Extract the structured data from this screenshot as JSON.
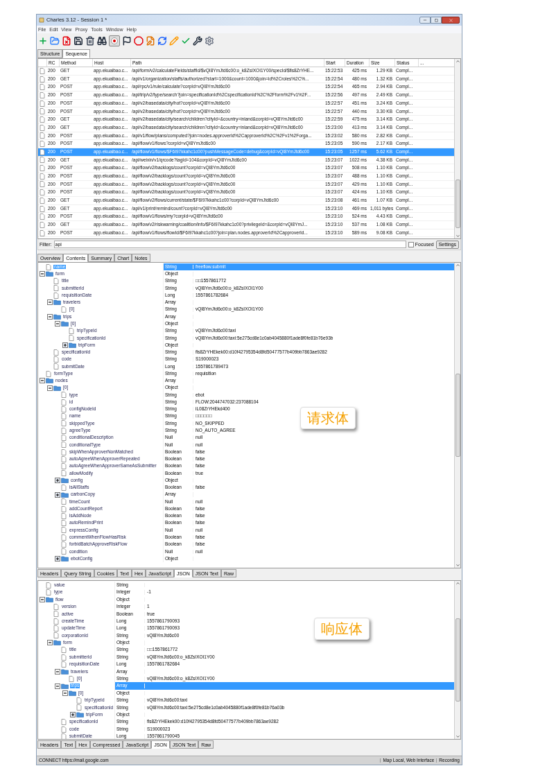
{
  "window": {
    "title": "Charles 3.12 - Session 1 *"
  },
  "menu": [
    "File",
    "Edit",
    "View",
    "Proxy",
    "Tools",
    "Window",
    "Help"
  ],
  "toolbar": {
    "recording": true
  },
  "view_tabs": [
    {
      "label": "Structure",
      "selected": false
    },
    {
      "label": "Sequence",
      "selected": true
    }
  ],
  "table": {
    "columns": [
      "RC",
      "Method",
      "Host",
      "Path",
      "Start",
      "Duration",
      "Size",
      "Status",
      "..."
    ],
    "rows": [
      {
        "rc": "200",
        "method": "GET",
        "host": "app.ekuaibao.c...",
        "path": "/api/form/v2/calculateFields/staffId/$vQI8YmJtd6c00:o_k8ZsIXOI1Y00/specId/$fls8ZrYHE...",
        "start": "15:22:53",
        "duration": "425 ms",
        "size": "1.29 KB",
        "status": "Compl...",
        "selected": false
      },
      {
        "rc": "200",
        "method": "GET",
        "host": "app.ekuaibao.c...",
        "path": "/api/v1/organization/staffs/authorized?start=1000&count=1000&join=id%2Croles%2C%...",
        "start": "15:22:54",
        "duration": "480 ms",
        "size": "1.32 KB",
        "status": "Compl...",
        "selected": false
      },
      {
        "rc": "200",
        "method": "POST",
        "host": "app.ekuaibao.c...",
        "path": "/api/rpc/v1/rule/calculate?corpId=vQI8YmJtd6c00",
        "start": "15:22:54",
        "duration": "465 ms",
        "size": "2.94 KB",
        "status": "Compl...",
        "selected": false
      },
      {
        "rc": "200",
        "method": "POST",
        "host": "app.ekuaibao.c...",
        "path": "/api/trip/v2/type/search?join=specificationId%2CspecificationId%2C%2Fform%2Fv1%2F...",
        "start": "15:22:56",
        "duration": "497 ms",
        "size": "2.49 KB",
        "status": "Compl...",
        "selected": false
      },
      {
        "rc": "200",
        "method": "POST",
        "host": "app.ekuaibao.c...",
        "path": "/api/v2/basedata/city/hot?corpId=vQI8YmJtd6c00",
        "start": "15:22:57",
        "duration": "451 ms",
        "size": "3.24 KB",
        "status": "Compl...",
        "selected": false
      },
      {
        "rc": "200",
        "method": "POST",
        "host": "app.ekuaibao.c...",
        "path": "/api/v2/basedata/city/hot?corpId=vQI8YmJtd6c00",
        "start": "15:22:57",
        "duration": "440 ms",
        "size": "3.30 KB",
        "status": "Compl...",
        "selected": false
      },
      {
        "rc": "200",
        "method": "GET",
        "host": "app.ekuaibao.c...",
        "path": "/api/v2/basedata/city/search/children?cityId=&country=inland&corpId=vQI8YmJtd6c00",
        "start": "15:22:59",
        "duration": "475 ms",
        "size": "3.14 KB",
        "status": "Compl...",
        "selected": false
      },
      {
        "rc": "200",
        "method": "GET",
        "host": "app.ekuaibao.c...",
        "path": "/api/v2/basedata/city/search/children?cityId=&country=inland&corpId=vQI8YmJtd6c00",
        "start": "15:23:00",
        "duration": "413 ms",
        "size": "3.14 KB",
        "status": "Compl...",
        "selected": false
      },
      {
        "rc": "200",
        "method": "POST",
        "host": "app.ekuaibao.c...",
        "path": "/api/v1/flow/plans/computed?join=nodes.approverId%2CapproverId%2C%2Fv1%2Forga...",
        "start": "15:23:02",
        "duration": "580 ms",
        "size": "2.82 KB",
        "status": "Compl...",
        "selected": false
      },
      {
        "rc": "200",
        "method": "POST",
        "host": "app.ekuaibao.c...",
        "path": "/api/flow/v1/flows?corpId=vQI8YmJtd6c00",
        "start": "15:23:05",
        "duration": "590 ms",
        "size": "2.17 KB",
        "status": "Compl...",
        "selected": false
      },
      {
        "rc": "200",
        "method": "POST",
        "host": "app.ekuaibao.c...",
        "path": "/api/flow/v1/flows/$F6I97kkahc1c00?pushMessageCode=debug&corpId=vQI8YmJtd6c00",
        "start": "15:23:05",
        "duration": "1257 ms",
        "size": "5.62 KB",
        "status": "Compl...",
        "selected": true
      },
      {
        "rc": "200",
        "method": "GET",
        "host": "app.ekuaibao.c...",
        "path": "/api/weixin/v1/qrcode?tagId=104&corpId=vQI8YmJtd6c00",
        "start": "15:23:07",
        "duration": "1022 ms",
        "size": "4.38 KB",
        "status": "Compl...",
        "selected": false
      },
      {
        "rc": "200",
        "method": "POST",
        "host": "app.ekuaibao.c...",
        "path": "/api/flow/v2/backlogs/count?corpId=vQI8YmJtd6c00",
        "start": "15:23:07",
        "duration": "508 ms",
        "size": "1.10 KB",
        "status": "Compl...",
        "selected": false
      },
      {
        "rc": "200",
        "method": "POST",
        "host": "app.ekuaibao.c...",
        "path": "/api/flow/v2/backlogs/count?corpId=vQI8YmJtd6c00",
        "start": "15:23:07",
        "duration": "488 ms",
        "size": "1.10 KB",
        "status": "Compl...",
        "selected": false
      },
      {
        "rc": "200",
        "method": "POST",
        "host": "app.ekuaibao.c...",
        "path": "/api/flow/v2/backlogs/count?corpId=vQI8YmJtd6c00",
        "start": "15:23:07",
        "duration": "429 ms",
        "size": "1.10 KB",
        "status": "Compl...",
        "selected": false
      },
      {
        "rc": "200",
        "method": "POST",
        "host": "app.ekuaibao.c...",
        "path": "/api/flow/v2/backlogs/count?corpId=vQI8YmJtd6c00",
        "start": "15:23:07",
        "duration": "424 ms",
        "size": "1.10 KB",
        "status": "Compl...",
        "selected": false
      },
      {
        "rc": "200",
        "method": "GET",
        "host": "app.ekuaibao.c...",
        "path": "/api/flow/v2/flows/current/state/$F6I97kkahc1c00?corpId=vQI8YmJtd6c00",
        "start": "15:23:08",
        "duration": "461 ms",
        "size": "1.07 KB",
        "status": "Compl...",
        "selected": false
      },
      {
        "rc": "200",
        "method": "GET",
        "host": "app.ekuaibao.c...",
        "path": "/api/v1/print/remind/count?corpId=vQI8YmJtd6c00",
        "start": "15:23:10",
        "duration": "469 ms",
        "size": "1,011 bytes",
        "status": "Compl...",
        "selected": false
      },
      {
        "rc": "200",
        "method": "POST",
        "host": "app.ekuaibao.c...",
        "path": "/api/flow/v1/flows/my?corpId=vQI8YmJtd6c00",
        "start": "15:23:10",
        "duration": "524 ms",
        "size": "4.43 KB",
        "status": "Compl...",
        "selected": false
      },
      {
        "rc": "200",
        "method": "GET",
        "host": "app.ekuaibao.c...",
        "path": "/api/flow/v2/riskwarning/coalition/info/$F6I97kkahc1c00?privilegeId=&corpId=vQI8YmJ...",
        "start": "15:23:10",
        "duration": "537 ms",
        "size": "1.08 KB",
        "status": "Compl...",
        "selected": false
      },
      {
        "rc": "200",
        "method": "POST",
        "host": "app.ekuaibao.c...",
        "path": "/api/flow/v1/flows/flowId/$F6I97kkahc1c00?join=plan.nodes.approverId%2CapproverId...",
        "start": "15:23:10",
        "duration": "589 ms",
        "size": "9.08 KB",
        "status": "Compl...",
        "selected": false
      }
    ]
  },
  "filter": {
    "label": "Filter:",
    "value": "api",
    "focused": {
      "label": "Focused",
      "checked": false
    },
    "settings": "Settings"
  },
  "detail_tabs": [
    {
      "label": "Overview",
      "selected": false
    },
    {
      "label": "Contents",
      "selected": true
    },
    {
      "label": "Summary",
      "selected": false
    },
    {
      "label": "Chart",
      "selected": false
    },
    {
      "label": "Notes",
      "selected": false
    }
  ],
  "request_tree": [
    {
      "name": "name",
      "type": "String",
      "value": "freeflow.submit",
      "kind": "leaf",
      "selected": true
    },
    {
      "name": "form",
      "type": "Object",
      "kind": "object",
      "expanded": true,
      "selected": false,
      "children": [
        {
          "name": "title",
          "type": "String",
          "value": "□□1557861772",
          "kind": "leaf",
          "selected": false
        },
        {
          "name": "submitterId",
          "type": "String",
          "value": "vQI8YmJtd6c00:o_k8ZsIXOI1Y00",
          "kind": "leaf",
          "selected": false
        },
        {
          "name": "requisitionDate",
          "type": "Long",
          "value": "1557861782684",
          "kind": "leaf",
          "selected": false
        },
        {
          "name": "travelers",
          "type": "Array",
          "kind": "object",
          "expanded": true,
          "selected": false,
          "children": [
            {
              "name": "[0]",
              "type": "String",
              "value": "vQI8YmJtd6c00:o_k8ZsIXOI1Y00",
              "kind": "leaf",
              "selected": false
            }
          ]
        },
        {
          "name": "trips",
          "type": "Array",
          "kind": "object",
          "expanded": true,
          "selected": false,
          "children": [
            {
              "name": "[0]",
              "type": "Object",
              "kind": "object",
              "expanded": true,
              "selected": false,
              "children": [
                {
                  "name": "tripTypeId",
                  "type": "String",
                  "value": "vQI8YmJtd6c00:taxi",
                  "kind": "leaf",
                  "selected": false
                },
                {
                  "name": "specificationId",
                  "type": "String",
                  "value": "vQI8YmJtd6c00:taxi:5e275cd8e1c0ab4045880f1ade8f0fe81b76e93b",
                  "kind": "leaf",
                  "selected": false
                },
                {
                  "name": "tripForm",
                  "type": "Object",
                  "kind": "object",
                  "expanded": false,
                  "selected": false
                }
              ]
            }
          ]
        },
        {
          "name": "specificationId",
          "type": "String",
          "value": "fls8ZrYHEkek00:d10f42795354d8fd50477577b409bb7863ae9282",
          "kind": "leaf",
          "selected": false
        },
        {
          "name": "code",
          "type": "String",
          "value": "S19000023",
          "kind": "leaf",
          "selected": false
        },
        {
          "name": "submitDate",
          "type": "Long",
          "value": "1557861789473",
          "kind": "leaf",
          "selected": false
        }
      ]
    },
    {
      "name": "formType",
      "type": "String",
      "value": "requisition",
      "kind": "leaf",
      "selected": false
    },
    {
      "name": "nodes",
      "type": "Array",
      "kind": "object",
      "expanded": true,
      "selected": false,
      "children": [
        {
          "name": "[0]",
          "type": "Object",
          "kind": "object",
          "expanded": true,
          "selected": false,
          "children": [
            {
              "name": "type",
              "type": "String",
              "value": "ebot",
              "kind": "leaf",
              "selected": false
            },
            {
              "name": "id",
              "type": "String",
              "value": "FLOW:2044747032:237088104",
              "kind": "leaf",
              "selected": false
            },
            {
              "name": "configNodeId",
              "type": "String",
              "value": "iL08ZrYHEkd400",
              "kind": "leaf",
              "selected": false
            },
            {
              "name": "name",
              "type": "String",
              "value": "□□□□□□",
              "kind": "leaf",
              "selected": false
            },
            {
              "name": "skippedType",
              "type": "String",
              "value": "NO_SKIPPED",
              "kind": "leaf",
              "selected": false
            },
            {
              "name": "agreeType",
              "type": "String",
              "value": "NO_AUTO_AGREE",
              "kind": "leaf",
              "selected": false
            },
            {
              "name": "conditionalDescription",
              "type": "Null",
              "value": "null",
              "kind": "leaf",
              "selected": false
            },
            {
              "name": "conditionalType",
              "type": "Null",
              "value": "null",
              "kind": "leaf",
              "selected": false
            },
            {
              "name": "skipWhenApproverNonMatched",
              "type": "Boolean",
              "value": "false",
              "kind": "leaf",
              "selected": false
            },
            {
              "name": "autoAgreeWhenApproverRepeated",
              "type": "Boolean",
              "value": "false",
              "kind": "leaf",
              "selected": false
            },
            {
              "name": "autoAgreeWhenApproverSameAsSubmitter",
              "type": "Boolean",
              "value": "false",
              "kind": "leaf",
              "selected": false
            },
            {
              "name": "allowModify",
              "type": "Boolean",
              "value": "true",
              "kind": "leaf",
              "selected": false
            },
            {
              "name": "config",
              "type": "Object",
              "kind": "object",
              "expanded": false,
              "selected": false
            },
            {
              "name": "isAllStaffs",
              "type": "Boolean",
              "value": "false",
              "kind": "leaf",
              "selected": false
            },
            {
              "name": "carbonCopy",
              "type": "Array",
              "kind": "object",
              "expanded": false,
              "selected": false
            },
            {
              "name": "timeCount",
              "type": "Null",
              "value": "null",
              "kind": "leaf",
              "selected": false
            },
            {
              "name": "addCountReport",
              "type": "Boolean",
              "value": "false",
              "kind": "leaf",
              "selected": false
            },
            {
              "name": "isAddNode",
              "type": "Boolean",
              "value": "false",
              "kind": "leaf",
              "selected": false
            },
            {
              "name": "autoRemindPrint",
              "type": "Boolean",
              "value": "false",
              "kind": "leaf",
              "selected": false
            },
            {
              "name": "expressConfig",
              "type": "Null",
              "value": "null",
              "kind": "leaf",
              "selected": false
            },
            {
              "name": "commentWhenFlowHasRisk",
              "type": "Boolean",
              "value": "false",
              "kind": "leaf",
              "selected": false
            },
            {
              "name": "forbidBatchApproveRiskFlow",
              "type": "Boolean",
              "value": "false",
              "kind": "leaf",
              "selected": false
            },
            {
              "name": "condition",
              "type": "Null",
              "value": "null",
              "kind": "leaf",
              "selected": false
            },
            {
              "name": "ebotConfig",
              "type": "Object",
              "kind": "object",
              "expanded": false,
              "selected": false
            }
          ]
        }
      ]
    }
  ],
  "request_annotation": "请求体",
  "request_tabs": [
    {
      "label": "Headers",
      "selected": false
    },
    {
      "label": "Query String",
      "selected": false
    },
    {
      "label": "Cookies",
      "selected": false
    },
    {
      "label": "Text",
      "selected": false
    },
    {
      "label": "Hex",
      "selected": false
    },
    {
      "label": "JavaScript",
      "selected": false
    },
    {
      "label": "JSON",
      "selected": true
    },
    {
      "label": "JSON Text",
      "selected": false
    },
    {
      "label": "Raw",
      "selected": false
    }
  ],
  "response_tree": [
    {
      "name": "value",
      "type": "String",
      "kind": "leaf",
      "selected": false
    },
    {
      "name": "type",
      "type": "Integer",
      "value": "-1",
      "kind": "leaf",
      "selected": false
    },
    {
      "name": "flow",
      "type": "Object",
      "kind": "object",
      "expanded": true,
      "selected": false,
      "children": [
        {
          "name": "version",
          "type": "Integer",
          "value": "1",
          "kind": "leaf",
          "selected": false
        },
        {
          "name": "active",
          "type": "Boolean",
          "value": "true",
          "kind": "leaf",
          "selected": false
        },
        {
          "name": "createTime",
          "type": "Long",
          "value": "1557861790093",
          "kind": "leaf",
          "selected": false
        },
        {
          "name": "updateTime",
          "type": "Long",
          "value": "1557861790093",
          "kind": "leaf",
          "selected": false
        },
        {
          "name": "corporationId",
          "type": "String",
          "value": "vQI8YmJtd6c00",
          "kind": "leaf",
          "selected": false
        },
        {
          "name": "form",
          "type": "Object",
          "kind": "object",
          "expanded": true,
          "selected": false,
          "children": [
            {
              "name": "title",
              "type": "String",
              "value": "□□1557861772",
              "kind": "leaf",
              "selected": false
            },
            {
              "name": "submitterId",
              "type": "String",
              "value": "vQI8YmJtd6c00:o_k8ZsIXOI1Y00",
              "kind": "leaf",
              "selected": false
            },
            {
              "name": "requisitionDate",
              "type": "Long",
              "value": "1557861782684",
              "kind": "leaf",
              "selected": false
            },
            {
              "name": "travelers",
              "type": "Array",
              "kind": "object",
              "expanded": true,
              "selected": false,
              "children": [
                {
                  "name": "[0]",
                  "type": "String",
                  "value": "vQI8YmJtd6c00:o_k8ZsIXOI1Y00",
                  "kind": "leaf",
                  "selected": false
                }
              ]
            },
            {
              "name": "trips",
              "type": "Array",
              "kind": "object",
              "expanded": true,
              "selected": true,
              "children": [
                {
                  "name": "[0]",
                  "type": "Object",
                  "kind": "object",
                  "expanded": true,
                  "selected": false,
                  "children": [
                    {
                      "name": "tripTypeId",
                      "type": "String",
                      "value": "vQI8YmJtd6c00:taxi",
                      "kind": "leaf",
                      "selected": false
                    },
                    {
                      "name": "specificationId",
                      "type": "String",
                      "value": "vQI8YmJtd6c00:taxi:5e275cd8e1c0ab4045880f1ade8f0fe81b76a03b",
                      "kind": "leaf",
                      "selected": false
                    },
                    {
                      "name": "tripForm",
                      "type": "Object",
                      "kind": "object",
                      "expanded": false,
                      "selected": false
                    }
                  ]
                }
              ]
            },
            {
              "name": "specificationId",
              "type": "String",
              "value": "fls8ZrYHEkek00:d10f42795354d8fd50477577b409bb7863ae9282",
              "kind": "leaf",
              "selected": false
            },
            {
              "name": "code",
              "type": "String",
              "value": "S19000023",
              "kind": "leaf",
              "selected": false
            },
            {
              "name": "submitDate",
              "type": "Long",
              "value": "1557861790045",
              "kind": "leaf",
              "selected": false
            }
          ]
        }
      ]
    }
  ],
  "response_annotation": "响应体",
  "response_tabs": [
    {
      "label": "Headers",
      "selected": false
    },
    {
      "label": "Text",
      "selected": false
    },
    {
      "label": "Hex",
      "selected": false
    },
    {
      "label": "Compressed",
      "selected": false
    },
    {
      "label": "JavaScript",
      "selected": false
    },
    {
      "label": "JSON",
      "selected": true
    },
    {
      "label": "JSON Text",
      "selected": false
    },
    {
      "label": "Raw",
      "selected": false
    }
  ],
  "status_bar": {
    "message": "CONNECT https://mail.google.com",
    "tools": "Map Local, Web Interface",
    "state": "Recording"
  }
}
